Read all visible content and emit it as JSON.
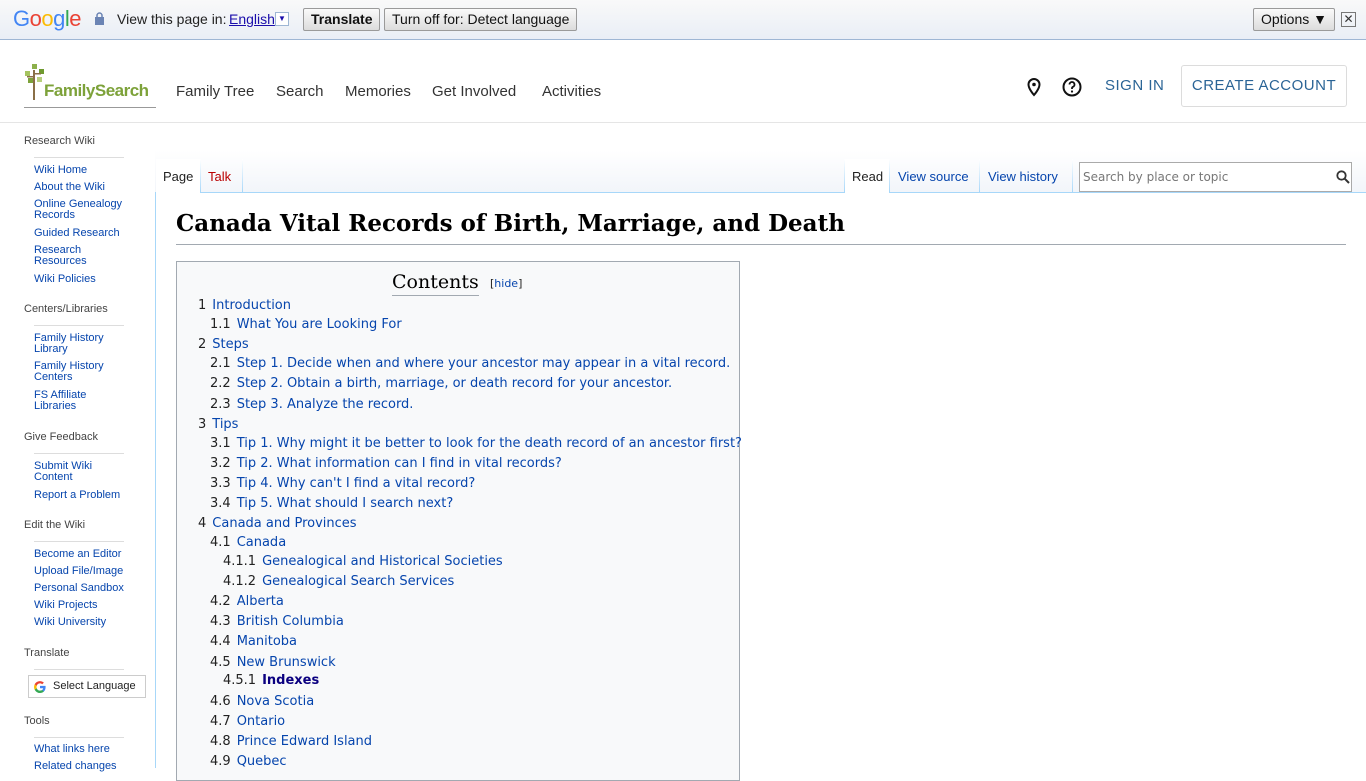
{
  "translate_bar": {
    "logo": [
      "G",
      "o",
      "o",
      "g",
      "l",
      "e"
    ],
    "logo_colors": [
      "#4285f4",
      "#ea4335",
      "#fbbc05",
      "#4285f4",
      "#34a853",
      "#ea4335"
    ],
    "prompt": "View this page in:",
    "language": "English",
    "translate_label": "Translate",
    "turn_off_label": "Turn off for: Detect language",
    "options_label": "Options ▼",
    "close": "✕"
  },
  "header": {
    "logo_text": "FamilySearch",
    "nav": [
      "Family Tree",
      "Search",
      "Memories",
      "Get Involved",
      "Activities"
    ],
    "sign_in": "SIGN IN",
    "create_account": "CREATE ACCOUNT",
    "icons": [
      "location-pin-icon",
      "help-icon"
    ]
  },
  "sidebar": {
    "sections": [
      {
        "heading": "Research Wiki",
        "links": [
          "Wiki Home",
          "About the Wiki",
          "Online Genealogy Records",
          "Guided Research",
          "Research Resources",
          "Wiki Policies"
        ]
      },
      {
        "heading": "Centers/Libraries",
        "links": [
          "Family History Library",
          "Family History Centers",
          "FS Affiliate Libraries"
        ]
      },
      {
        "heading": "Give Feedback",
        "links": [
          "Submit Wiki Content",
          "Report a Problem"
        ]
      },
      {
        "heading": "Edit the Wiki",
        "links": [
          "Become an Editor",
          "Upload File/Image",
          "Personal Sandbox",
          "Wiki Projects",
          "Wiki University"
        ]
      },
      {
        "heading": "Translate",
        "select_label": "Select Language"
      },
      {
        "heading": "Tools",
        "links": [
          "What links here",
          "Related changes"
        ]
      }
    ]
  },
  "tabs": {
    "left": [
      "Page",
      "Talk"
    ],
    "right": [
      "Read",
      "View source",
      "View history"
    ]
  },
  "search": {
    "placeholder": "Search by place or topic"
  },
  "page": {
    "title": "Canada Vital Records of Birth, Marriage, and Death",
    "toc_title": "Contents",
    "toc_hide": "hide",
    "toc": [
      {
        "num": "1",
        "text": "Introduction",
        "level": 1
      },
      {
        "num": "1.1",
        "text": "What You are Looking For",
        "level": 2
      },
      {
        "num": "2",
        "text": "Steps",
        "level": 1
      },
      {
        "num": "2.1",
        "text": "Step 1. Decide when and where your ancestor may appear in a vital record.",
        "level": 2
      },
      {
        "num": "2.2",
        "text": "Step 2. Obtain a birth, marriage, or death record for your ancestor.",
        "level": 2
      },
      {
        "num": "2.3",
        "text": "Step 3. Analyze the record.",
        "level": 2
      },
      {
        "num": "3",
        "text": "Tips",
        "level": 1
      },
      {
        "num": "3.1",
        "text": "Tip 1. Why might it be better to look for the death record of an ancestor first?",
        "level": 2
      },
      {
        "num": "3.2",
        "text": "Tip 2. What information can I find in vital records?",
        "level": 2
      },
      {
        "num": "3.3",
        "text": "Tip 4. Why can't I find a vital record?",
        "level": 2
      },
      {
        "num": "3.4",
        "text": "Tip 5. What should I search next?",
        "level": 2
      },
      {
        "num": "4",
        "text": "Canada and Provinces",
        "level": 1
      },
      {
        "num": "4.1",
        "text": "Canada",
        "level": 2
      },
      {
        "num": "4.1.1",
        "text": "Genealogical and Historical Societies",
        "level": 3
      },
      {
        "num": "4.1.2",
        "text": "Genealogical Search Services",
        "level": 3
      },
      {
        "num": "4.2",
        "text": "Alberta",
        "level": 2
      },
      {
        "num": "4.3",
        "text": "British Columbia",
        "level": 2
      },
      {
        "num": "4.4",
        "text": "Manitoba",
        "level": 2
      },
      {
        "num": "4.5",
        "text": "New Brunswick",
        "level": 2
      },
      {
        "num": "4.5.1",
        "text": "Indexes",
        "level": 3,
        "bold": true
      },
      {
        "num": "4.6",
        "text": "Nova Scotia",
        "level": 2
      },
      {
        "num": "4.7",
        "text": "Ontario",
        "level": 2
      },
      {
        "num": "4.8",
        "text": "Prince Edward Island",
        "level": 2
      },
      {
        "num": "4.9",
        "text": "Quebec",
        "level": 2
      }
    ]
  }
}
